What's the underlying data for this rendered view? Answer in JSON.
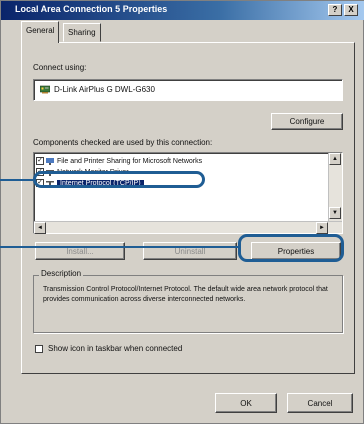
{
  "window": {
    "title": "Local Area Connection 5 Properties",
    "help_btn": "?",
    "close_btn": "X"
  },
  "tabs": [
    {
      "label": "General",
      "active": true
    },
    {
      "label": "Sharing",
      "active": false
    }
  ],
  "connect_using": {
    "label": "Connect using:",
    "adapter": "D-Link AirPlus G DWL-G630",
    "configure_btn": "Configure"
  },
  "components": {
    "label": "Components checked are used by this connection:",
    "items": [
      {
        "label": "File and Printer Sharing for Microsoft Networks",
        "checked": true,
        "selected": false
      },
      {
        "label": "Network Monitor Driver",
        "checked": true,
        "selected": false
      },
      {
        "label": "Internet Protocol (TCP/IP)",
        "checked": true,
        "selected": true
      }
    ],
    "install_btn": "Install...",
    "uninstall_btn": "Uninstall",
    "properties_btn": "Properties"
  },
  "description": {
    "label": "Description",
    "text": "Transmission Control Protocol/Internet Protocol. The default wide area network protocol that provides communication across diverse interconnected networks."
  },
  "show_icon": {
    "label": "Show icon in taskbar when connected",
    "checked": false
  },
  "footer": {
    "ok_btn": "OK",
    "cancel_btn": "Cancel"
  },
  "colors": {
    "title_bar": "#0a246a",
    "selection": "#0a246a",
    "highlight_callout": "#1f5d94",
    "dialog_face": "#d4d0c8"
  }
}
